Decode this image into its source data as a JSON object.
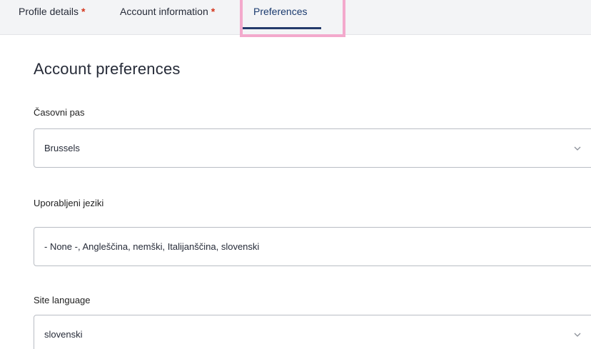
{
  "tabs": [
    {
      "label": "Profile details",
      "required": "*"
    },
    {
      "label": "Account information",
      "required": "*"
    },
    {
      "label": "Preferences",
      "required": ""
    }
  ],
  "active_tab": "Preferences",
  "section": {
    "title": "Account preferences"
  },
  "fields": {
    "timezone": {
      "label": "Časovni pas",
      "value": "Brussels",
      "icon": "chevron-down-icon"
    },
    "languages": {
      "label": "Uporabljeni jeziki",
      "value": "- None -, Angleščina, nemški, Italijanščina, slovenski"
    },
    "site_language": {
      "label": "Site language",
      "value": "slovenski",
      "icon": "chevron-down-icon"
    }
  },
  "colors": {
    "required": "#d4351c",
    "active_underline": "#233a6b",
    "highlight": "#f3a9cc"
  }
}
